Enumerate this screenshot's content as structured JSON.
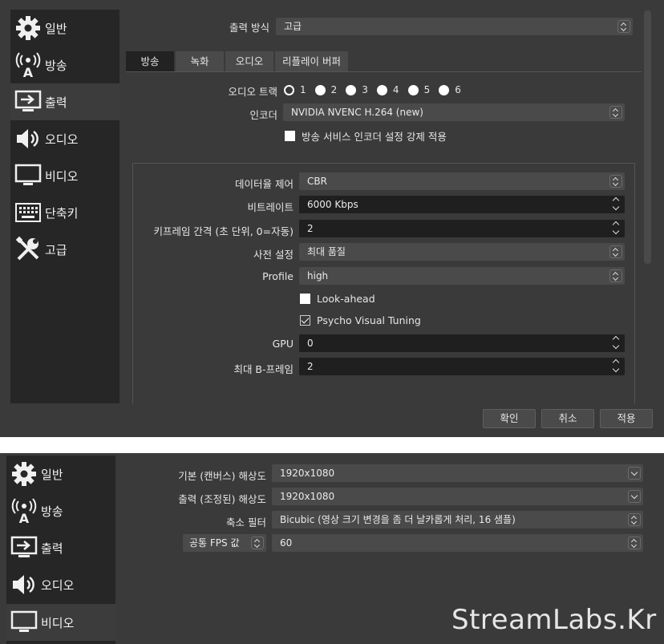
{
  "top": {
    "sidebar": [
      {
        "label": "일반",
        "icon": "gear-icon"
      },
      {
        "label": "방송",
        "icon": "broadcast-antenna-icon"
      },
      {
        "label": "출력",
        "icon": "output-monitor-icon"
      },
      {
        "label": "오디오",
        "icon": "speaker-icon"
      },
      {
        "label": "비디오",
        "icon": "monitor-icon"
      },
      {
        "label": "단축키",
        "icon": "keyboard-icon"
      },
      {
        "label": "고급",
        "icon": "tools-icon"
      }
    ],
    "output_mode": {
      "label": "출력 방식",
      "value": "고급"
    },
    "tabs": [
      "방송",
      "녹화",
      "오디오",
      "리플레이 버퍼"
    ],
    "audio_track": {
      "label": "오디오 트랙",
      "options": [
        "1",
        "2",
        "3",
        "4",
        "5",
        "6"
      ],
      "selected": "1"
    },
    "encoder": {
      "label": "인코더",
      "value": "NVIDIA NVENC H.264 (new)"
    },
    "enforce_encoder": {
      "label": "방송 서비스 인코더 설정 강제 적용",
      "checked": false
    },
    "rate_control": {
      "label": "데이터율 제어",
      "value": "CBR"
    },
    "bitrate": {
      "label": "비트레이트",
      "value": "6000 Kbps"
    },
    "keyframe": {
      "label": "키프레임 간격 (초 단위, 0=자동)",
      "value": "2"
    },
    "preset": {
      "label": "사전 설정",
      "value": "최대 품질"
    },
    "profile": {
      "label": "Profile",
      "value": "high"
    },
    "lookahead": {
      "label": "Look-ahead",
      "checked": false
    },
    "psycho": {
      "label": "Psycho Visual Tuning",
      "checked": true
    },
    "gpu": {
      "label": "GPU",
      "value": "0"
    },
    "bframes": {
      "label": "최대 B-프레임",
      "value": "2"
    },
    "buttons": {
      "ok": "확인",
      "cancel": "취소",
      "apply": "적용"
    }
  },
  "bottom": {
    "sidebar": [
      {
        "label": "일반",
        "icon": "gear-icon"
      },
      {
        "label": "방송",
        "icon": "broadcast-antenna-icon"
      },
      {
        "label": "출력",
        "icon": "output-monitor-icon"
      },
      {
        "label": "오디오",
        "icon": "speaker-icon"
      },
      {
        "label": "비디오",
        "icon": "monitor-icon"
      }
    ],
    "base_res": {
      "label": "기본 (캔버스) 해상도",
      "value": "1920x1080"
    },
    "output_res": {
      "label": "출력 (조정된) 해상도",
      "value": "1920x1080"
    },
    "downscale": {
      "label": "축소 필터",
      "value": "Bicubic (영상 크기 변경을 좀 더 날카롭게 처리, 16 샘플)"
    },
    "fps": {
      "label": "공통 FPS 값",
      "value": "60"
    }
  },
  "watermark": "StreamLabs.Kr"
}
